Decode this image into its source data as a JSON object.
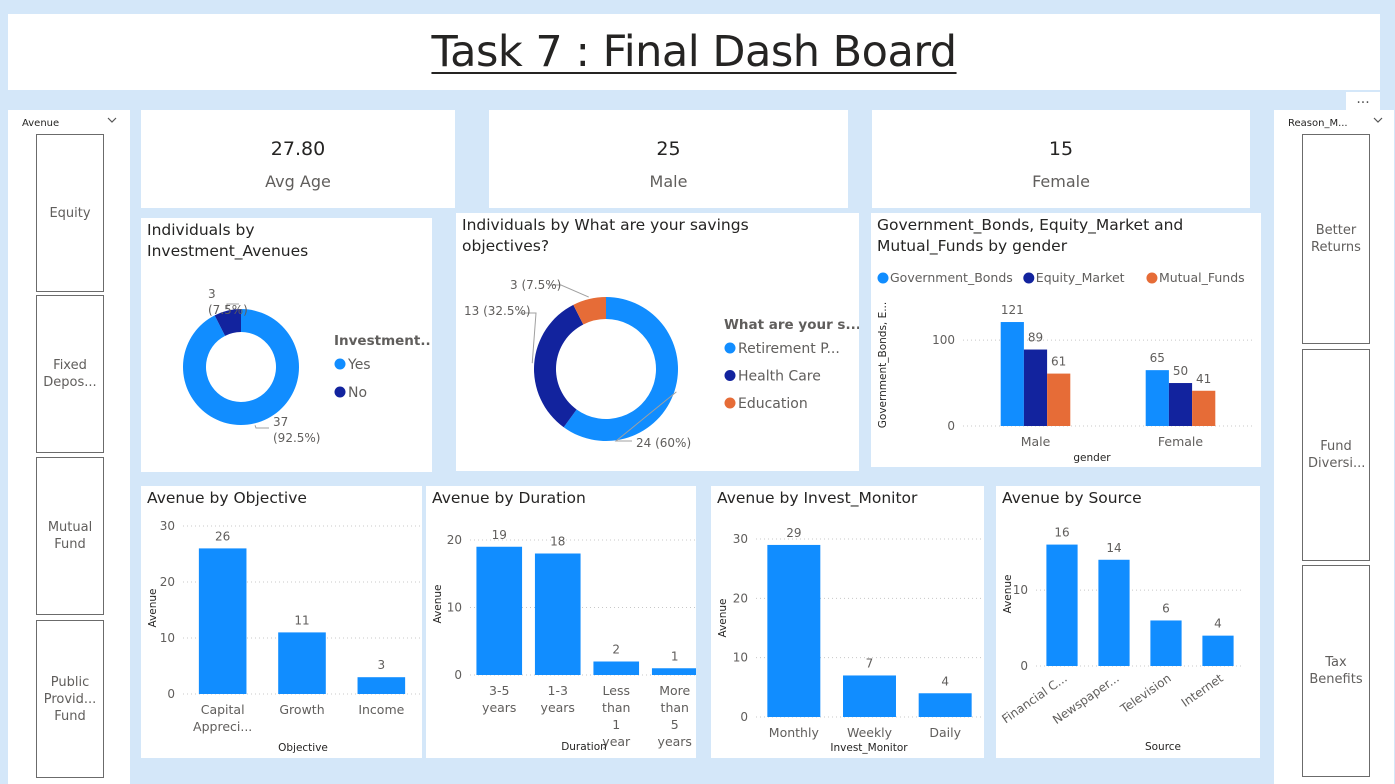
{
  "page_title": "Task 7 : Final Dash Board",
  "more_options": "...",
  "left_slicer": {
    "header": "Avenue",
    "items": [
      "Equity",
      "Fixed Depos...",
      "Mutual Fund",
      "Public Provid... Fund"
    ]
  },
  "right_slicer": {
    "header": "Reason_M...",
    "items": [
      "Better Returns",
      "Fund Diversi...",
      "Tax Benefits"
    ]
  },
  "kpis": [
    {
      "value": "27.80",
      "label": "Avg Age"
    },
    {
      "value": "25",
      "label": "Male"
    },
    {
      "value": "15",
      "label": "Female"
    }
  ],
  "colors": {
    "primary": "#118dff",
    "dark": "#12239e",
    "orange": "#e66c37",
    "background": "#d4e7f9"
  },
  "chart_data": [
    {
      "id": "investment_avenues",
      "type": "pie",
      "donut": true,
      "title": "Individuals by Investment_Avenues",
      "legend_title": "Investment...",
      "legend_position": "right",
      "slices": [
        {
          "label": "Yes",
          "value": 37,
          "label_text": "37 (92.5%)",
          "color": "#118dff"
        },
        {
          "label": "No",
          "value": 3,
          "label_text": "3 (7.5%)",
          "color": "#12239e"
        }
      ]
    },
    {
      "id": "savings_objectives",
      "type": "pie",
      "donut": true,
      "title": "Individuals by What are your savings objectives?",
      "legend_title": "What are your s...",
      "legend_position": "right",
      "slices": [
        {
          "label": "Retirement P...",
          "value": 24,
          "label_text": "24 (60%)",
          "color": "#118dff"
        },
        {
          "label": "Health Care",
          "value": 13,
          "label_text": "13 (32.5%)",
          "color": "#12239e"
        },
        {
          "label": "Education",
          "value": 3,
          "label_text": "3 (7.5%)",
          "color": "#e66c37"
        }
      ]
    },
    {
      "id": "bonds_by_gender",
      "type": "bar",
      "title": "Government_Bonds, Equity_Market and Mutual_Funds by gender",
      "legend_position": "top-left",
      "categories": [
        "Male",
        "Female"
      ],
      "series": [
        {
          "name": "Government_Bonds",
          "color": "#118dff",
          "values": [
            121,
            65
          ]
        },
        {
          "name": "Equity_Market",
          "color": "#12239e",
          "values": [
            89,
            50
          ]
        },
        {
          "name": "Mutual_Funds",
          "color": "#e66c37",
          "values": [
            61,
            41
          ]
        }
      ],
      "xlabel": "gender",
      "ylabel": "Government_Bonds, E...",
      "yticks": [
        0,
        100
      ],
      "ylim": [
        0,
        135
      ],
      "grid": true
    },
    {
      "id": "avenue_by_objective",
      "type": "bar",
      "title": "Avenue by Objective",
      "categories": [
        "Capital Appreci...",
        "Growth",
        "Income"
      ],
      "values": [
        26,
        11,
        3
      ],
      "xlabel": "Objective",
      "ylabel": "Avenue",
      "yticks": [
        0,
        10,
        20,
        30
      ],
      "ylim": [
        0,
        30
      ],
      "grid": true
    },
    {
      "id": "avenue_by_duration",
      "type": "bar",
      "title": "Avenue by Duration",
      "categories": [
        "3-5 years",
        "1-3 years",
        "Less than 1 year",
        "More than 5 years"
      ],
      "values": [
        19,
        18,
        2,
        1
      ],
      "xlabel": "Duration",
      "ylabel": "Avenue",
      "yticks": [
        0,
        10,
        20
      ],
      "ylim": [
        0,
        20
      ],
      "grid": true
    },
    {
      "id": "avenue_by_invest_monitor",
      "type": "bar",
      "title": "Avenue by Invest_Monitor",
      "categories": [
        "Monthly",
        "Weekly",
        "Daily"
      ],
      "values": [
        29,
        7,
        4
      ],
      "xlabel": "Invest_Monitor",
      "ylabel": "Avenue",
      "yticks": [
        0,
        10,
        20,
        30
      ],
      "ylim": [
        0,
        30
      ],
      "grid": true
    },
    {
      "id": "avenue_by_source",
      "type": "bar",
      "title": "Avenue by Source",
      "categories": [
        "Financial C...",
        "Newspaper...",
        "Television",
        "Internet"
      ],
      "values": [
        16,
        14,
        6,
        4
      ],
      "xlabel": "Source",
      "ylabel": "Avenue",
      "yticks": [
        0,
        10
      ],
      "ylim": [
        0,
        17
      ],
      "grid": true
    }
  ]
}
